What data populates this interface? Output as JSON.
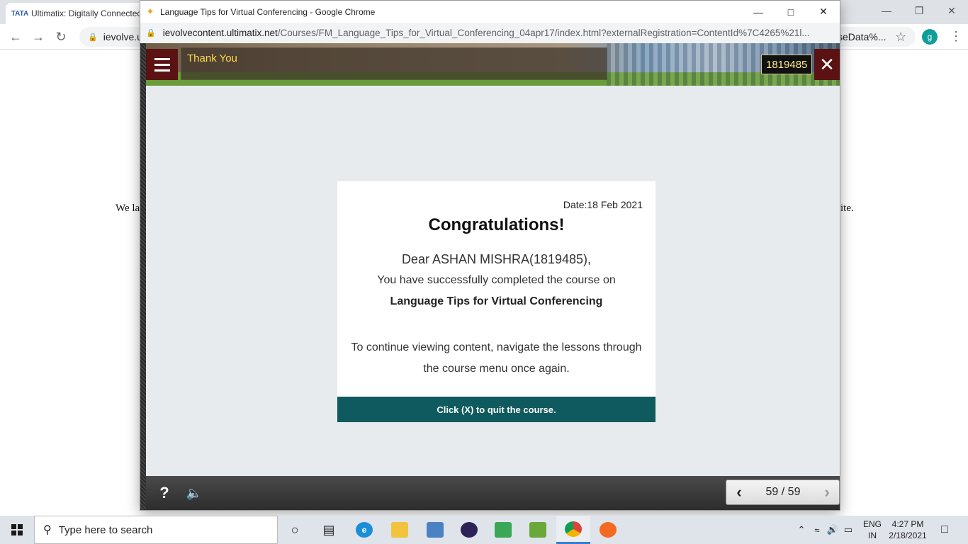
{
  "background_window": {
    "tab_title": "Ultimatix: Digitally Connected",
    "tab_logo_text": "TATA",
    "url_host": "ievolve.u",
    "url_tail": "seData%...",
    "avatar_letter": "g",
    "page_text_left": "We la",
    "page_text_right": "ite."
  },
  "popup_window": {
    "title": "Language Tips for Virtual Conferencing - Google Chrome",
    "url_host": "ievolvecontent.ultimatix.net",
    "url_path": "/Courses/FM_Language_Tips_for_Virtual_Conferencing_04apr17/index.html?externalRegistration=ContentId%7C4265%21l..."
  },
  "course_header": {
    "title": "Thank You",
    "employee_id": "1819485",
    "close_symbol": "✕"
  },
  "certificate": {
    "date": "Date:18 Feb 2021",
    "heading": "Congratulations!",
    "dear_line": "Dear ASHAN MISHRA(1819485),",
    "completed_line": "You have successfully completed the course on",
    "course_name": "Language Tips for Virtual Conferencing",
    "continue_line": "To continue viewing content, navigate the lessons through the course menu once again.",
    "footer": "Click (X) to quit the course."
  },
  "player_bottom": {
    "help_symbol": "?",
    "page_count": "59 / 59",
    "prev_symbol": "‹",
    "next_symbol": "›"
  },
  "taskbar": {
    "search_placeholder": "Type here to search",
    "lang_top": "ENG",
    "lang_bottom": "IN",
    "time": "4:27 PM",
    "date": "2/18/2021"
  },
  "colors": {
    "accent_teal": "#0f5a5e",
    "menu_maroon": "#5a1212",
    "title_yellow": "#ffd84a"
  }
}
